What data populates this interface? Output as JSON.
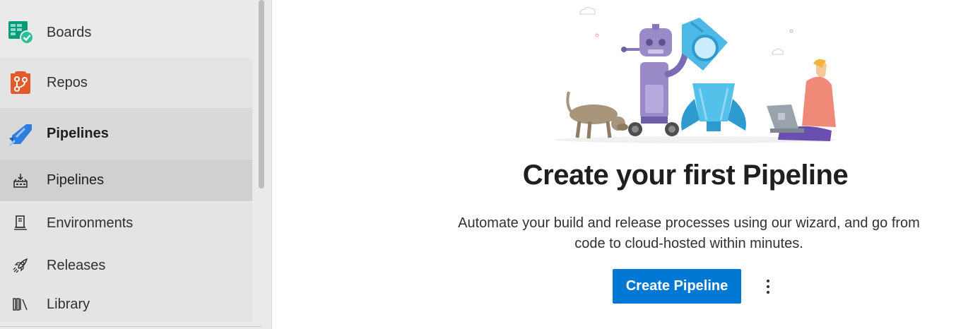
{
  "sidebar": {
    "items": [
      {
        "label": "Boards",
        "icon": "boards-icon"
      },
      {
        "label": "Repos",
        "icon": "repos-icon"
      },
      {
        "label": "Pipelines",
        "icon": "pipelines-icon",
        "selected": true
      },
      {
        "label": "Pipelines",
        "icon": "pipelines-sub-icon",
        "selected": true
      },
      {
        "label": "Environments",
        "icon": "environments-icon"
      },
      {
        "label": "Releases",
        "icon": "releases-icon"
      },
      {
        "label": "Library",
        "icon": "library-icon"
      }
    ]
  },
  "main": {
    "title": "Create your first Pipeline",
    "description_line1": "Automate your build and release processes using our wizard, and go from",
    "description_line2": "code to cloud-hosted within minutes.",
    "primary_button": "Create Pipeline",
    "more_icon": "more-vertical-icon"
  },
  "colors": {
    "accent": "#0078d4",
    "sidebar_bg": "#eaeaea",
    "selected_bg": "#d0d0d0",
    "boards_green": "#009d7b",
    "repos_orange": "#e05a2b",
    "pipelines_blue": "#2f7de1"
  }
}
